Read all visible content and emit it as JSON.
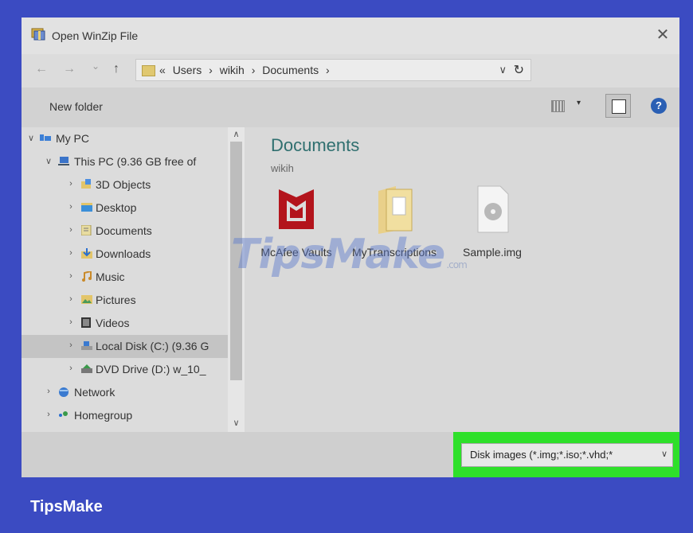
{
  "window": {
    "title": "Open WinZip File",
    "close_symbol": "✕"
  },
  "nav": {
    "back_symbol": "←",
    "forward_symbol": "→",
    "recent_symbol": "⌄",
    "up_symbol": "↑",
    "breadcrumbs": [
      "«",
      "Users",
      "›",
      "wikih",
      "›",
      "Documents",
      "›"
    ],
    "dropdown_symbol": "∨",
    "refresh_symbol": "↻"
  },
  "toolbar": {
    "new_folder": "New folder",
    "view_dropdown_symbol": "▾",
    "help_symbol": "?"
  },
  "sidebar": {
    "items": [
      {
        "label": "My PC",
        "chevron": "∨",
        "icon": "pc-icon"
      },
      {
        "label": "This PC (9.36 GB free of",
        "chevron": "∨",
        "icon": "computer-icon"
      },
      {
        "label": "3D Objects",
        "chevron": "›",
        "icon": "3d-objects-icon"
      },
      {
        "label": "Desktop",
        "chevron": "›",
        "icon": "desktop-icon"
      },
      {
        "label": "Documents",
        "chevron": "›",
        "icon": "documents-icon"
      },
      {
        "label": "Downloads",
        "chevron": "›",
        "icon": "downloads-icon"
      },
      {
        "label": "Music",
        "chevron": "›",
        "icon": "music-icon"
      },
      {
        "label": "Pictures",
        "chevron": "›",
        "icon": "pictures-icon"
      },
      {
        "label": "Videos",
        "chevron": "›",
        "icon": "videos-icon"
      },
      {
        "label": "Local Disk (C:) (9.36 G",
        "chevron": "›",
        "icon": "disk-icon",
        "selected": true
      },
      {
        "label": "DVD Drive (D:) w_10_",
        "chevron": "›",
        "icon": "dvd-icon"
      },
      {
        "label": "Network",
        "chevron": "›",
        "icon": "network-icon"
      },
      {
        "label": "Homegroup",
        "chevron": "›",
        "icon": "homegroup-icon"
      }
    ],
    "scroll_up_symbol": "∧",
    "scroll_down_symbol": "∨"
  },
  "content": {
    "title": "Documents",
    "subtitle": "wikih",
    "files": [
      {
        "name": "McAfee Vaults",
        "icon": "mcafee-icon"
      },
      {
        "name": "MyTranscriptions",
        "icon": "folder-icon"
      },
      {
        "name": "Sample.img",
        "icon": "disc-image-icon"
      }
    ]
  },
  "footer": {
    "filter_label": "Disk images (*.img;*.iso;*.vhd;*",
    "filter_chevron": "∨"
  },
  "watermark": {
    "text": "TipsMake",
    "suffix": ".com"
  },
  "brand": "TipsMake",
  "colors": {
    "frame": "#3b4bc2",
    "highlight": "#2ee02a",
    "help": "#2a5fb4",
    "mcafee": "#b3141c"
  }
}
